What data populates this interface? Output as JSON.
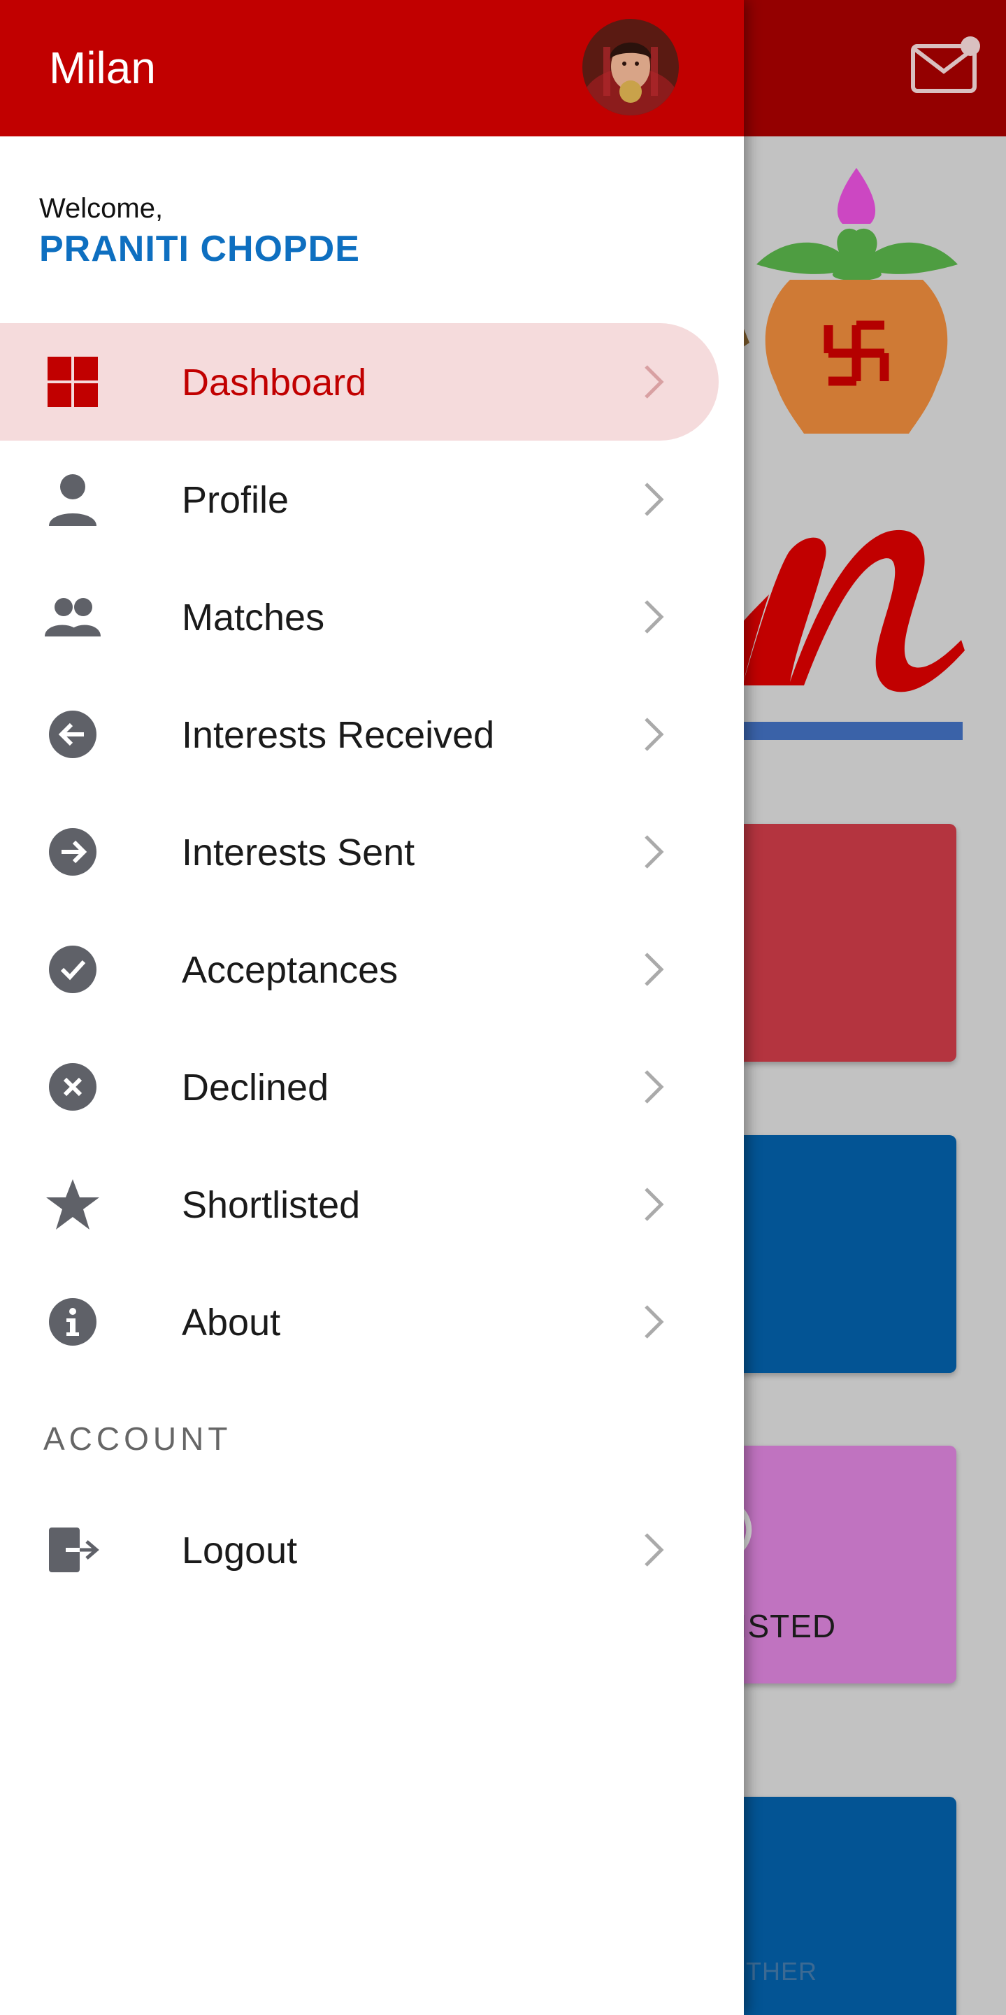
{
  "drawer": {
    "app_title": "Milan",
    "welcome_text": "Welcome,",
    "user_name": "PRANITI CHOPDE",
    "menu": [
      {
        "label": "Dashboard",
        "icon": "dashboard-icon",
        "active": true
      },
      {
        "label": "Profile",
        "icon": "person-icon"
      },
      {
        "label": "Matches",
        "icon": "people-icon"
      },
      {
        "label": "Interests Received",
        "icon": "arrow-left-circle-icon"
      },
      {
        "label": "Interests Sent",
        "icon": "arrow-right-circle-icon"
      },
      {
        "label": "Acceptances",
        "icon": "check-circle-icon"
      },
      {
        "label": "Declined",
        "icon": "cancel-circle-icon"
      },
      {
        "label": "Shortlisted",
        "icon": "star-icon"
      },
      {
        "label": "About",
        "icon": "info-circle-icon"
      }
    ],
    "account_section_label": "ACCOUNT",
    "account_menu": [
      {
        "label": "Logout",
        "icon": "logout-icon"
      }
    ]
  },
  "background": {
    "tile3_text": "TLISTED",
    "tile4_text": "D OTHER"
  },
  "colors": {
    "header_red": "#c10000",
    "active_bg": "#f5dbdc",
    "user_name_blue": "#0e6fc0",
    "icon_gray": "#5f6168"
  }
}
